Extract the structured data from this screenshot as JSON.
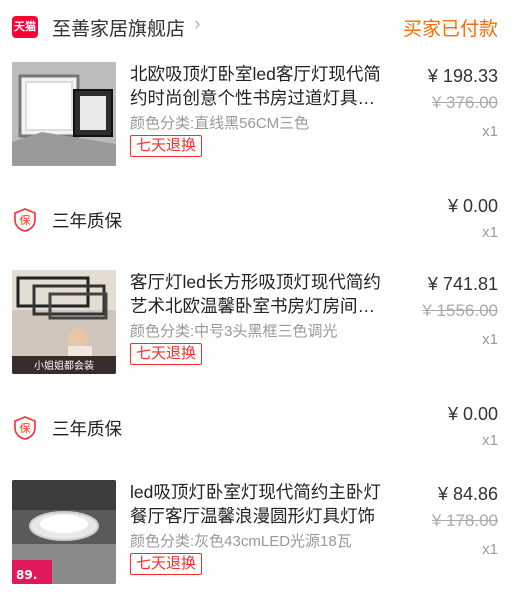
{
  "shop": {
    "badge": "天猫",
    "name": "至善家居旗舰店",
    "chevron": "›",
    "status": "买家已付款"
  },
  "items": [
    {
      "title": "北欧吸顶灯卧室led客厅灯现代简约时尚创意个性书房过道灯具…",
      "sku": "颜色分类:直线黑56CM三色",
      "refund": "七天退换",
      "price": "¥ 198.33",
      "orig_price": "¥ 376.00",
      "qty": "x1"
    },
    {
      "title": "客厅灯led长方形吸顶灯现代简约艺术北欧温馨卧室书房灯房间…",
      "sku": "颜色分类:中号3头黑框三色调光",
      "refund": "七天退换",
      "price": "¥ 741.81",
      "orig_price": "¥ 1556.00",
      "qty": "x1",
      "thumb_caption": "小姐姐都会装"
    },
    {
      "title": "led吸顶灯卧室灯现代简约主卧灯餐厅客厅温馨浪漫圆形灯具灯饰",
      "sku": "颜色分类:灰色43cmLED光源18瓦",
      "refund": "七天退换",
      "price": "¥ 84.86",
      "orig_price": "¥ 178.00",
      "qty": "x1",
      "thumb_caption": "89."
    }
  ],
  "warranties": [
    {
      "icon": "保",
      "label": "三年质保",
      "price": "¥ 0.00",
      "qty": "x1"
    },
    {
      "icon": "保",
      "label": "三年质保",
      "price": "¥ 0.00",
      "qty": "x1"
    }
  ],
  "colors": {
    "accent_orange": "#ff6a00",
    "refund_red": "#ff2c2c",
    "tmall_red": "#ff0036"
  }
}
